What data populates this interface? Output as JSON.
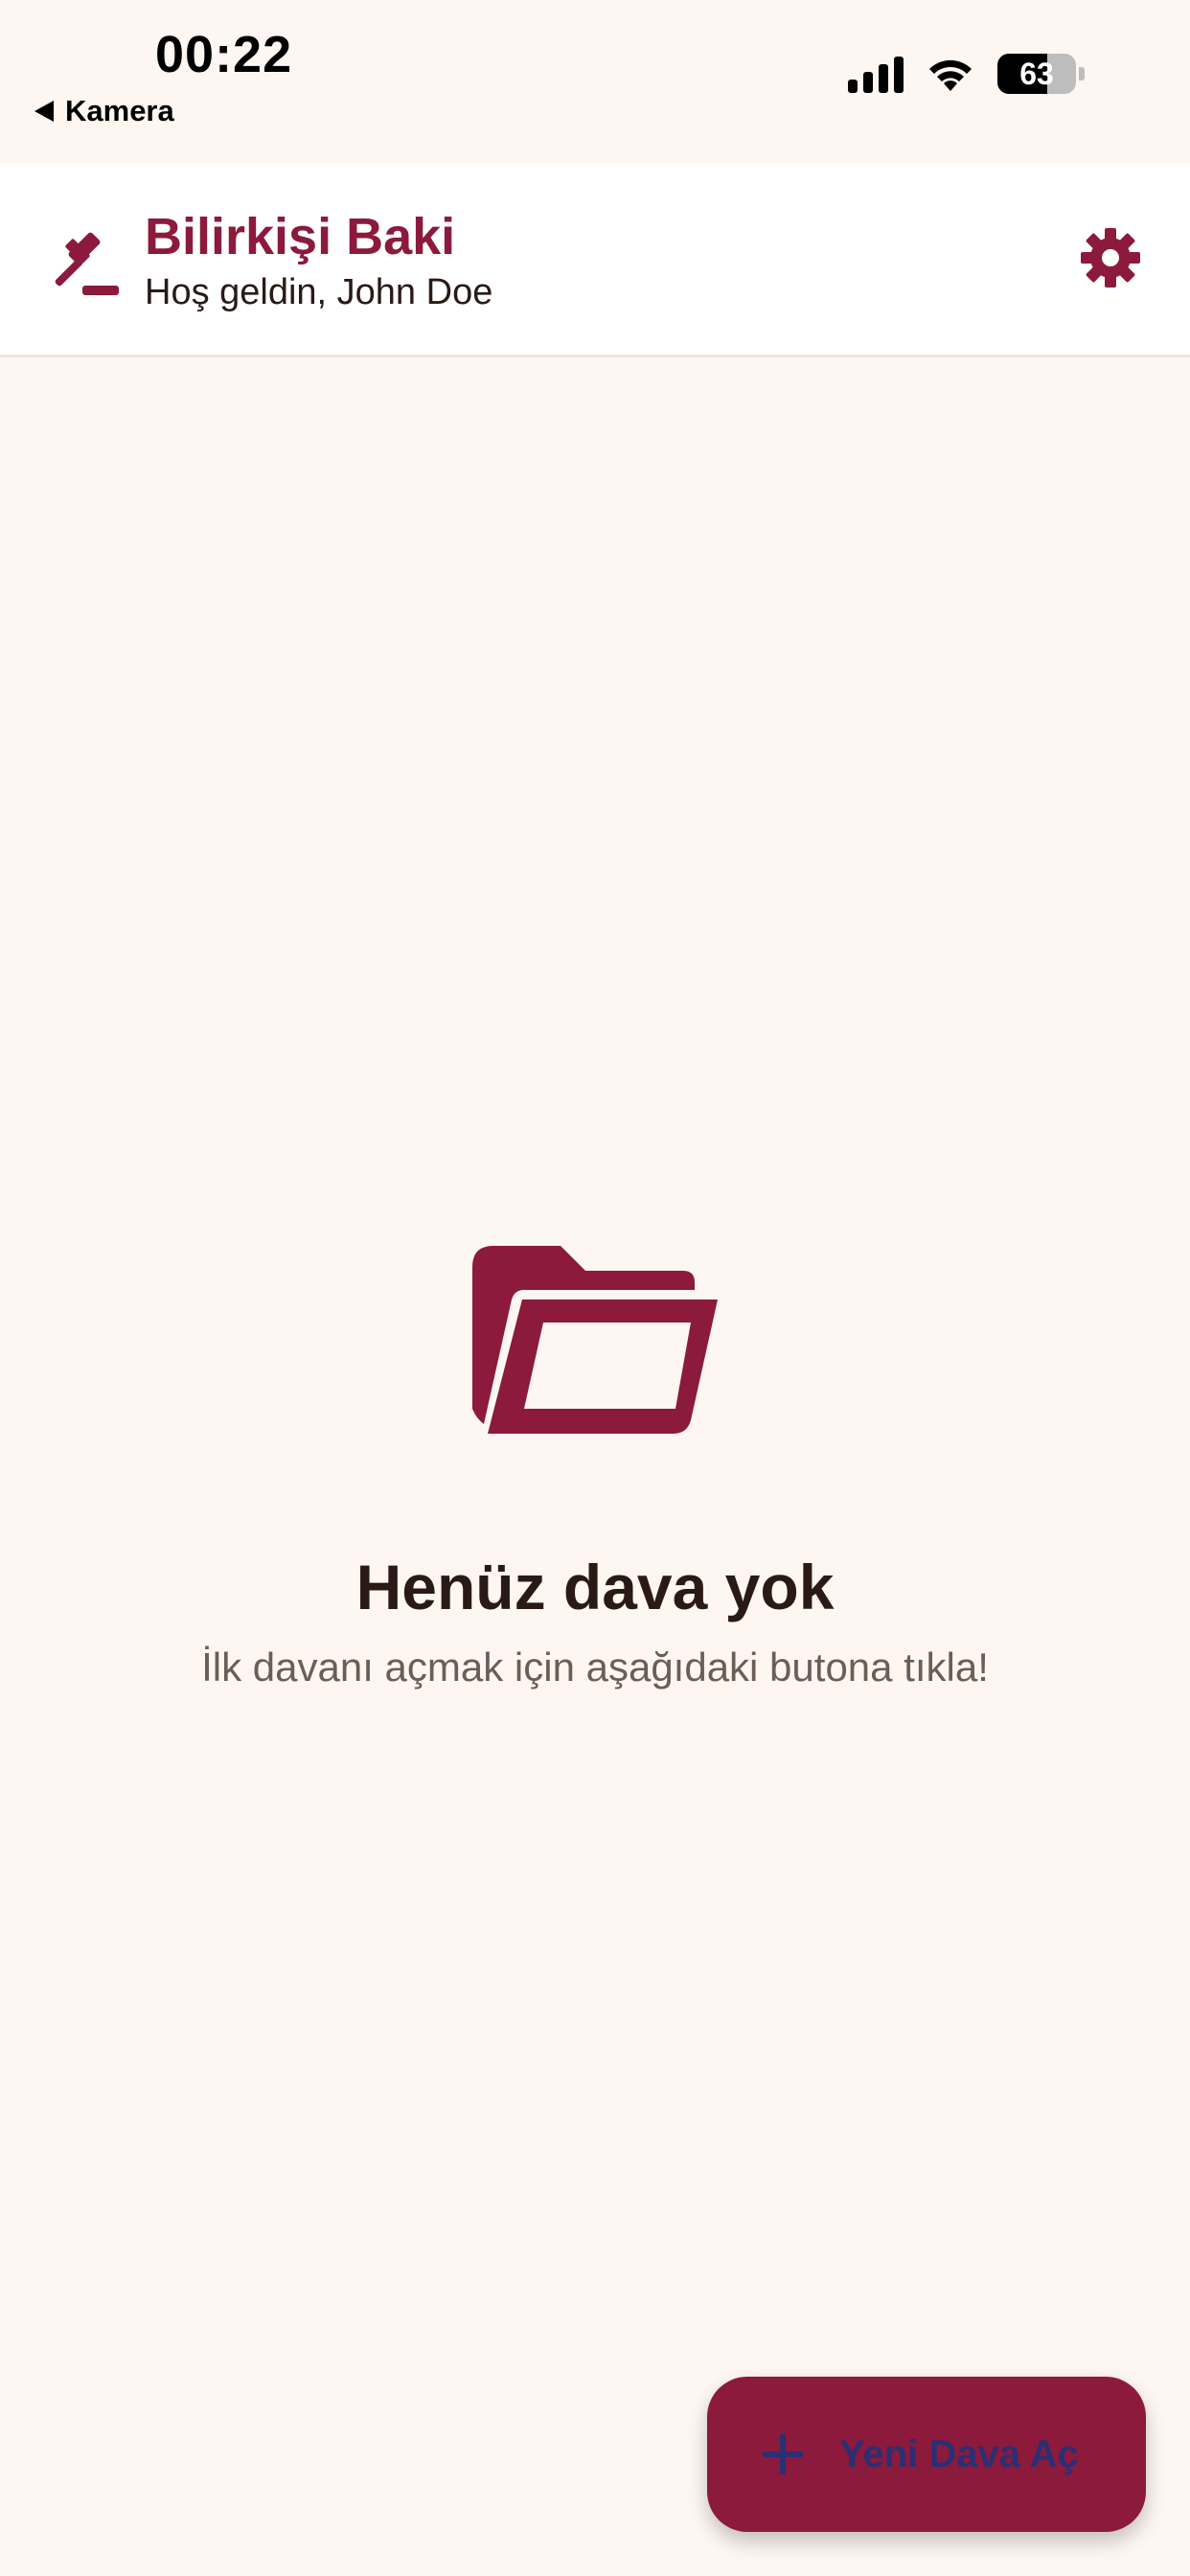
{
  "status_bar": {
    "time": "00:22",
    "back_label": "Kamera",
    "battery_percent": "63",
    "battery_level": 0.63
  },
  "header": {
    "title": "Bilirkişi Baki",
    "subtitle": "Hoş geldin, John Doe",
    "leading_icon": "gavel-icon",
    "trailing_icon": "gear-icon"
  },
  "empty_state": {
    "icon": "folder-open-icon",
    "title": "Henüz dava yok",
    "message": "İlk davanı açmak için aşağıdaki butona tıkla!"
  },
  "fab": {
    "icon": "plus-icon",
    "label": "Yeni Dava Aç"
  },
  "colors": {
    "accent": "#8B1A3C",
    "background": "#FDF6F1",
    "header_bg": "#FFFFFF",
    "text_dark": "#2A1A16",
    "text_muted": "#6B5D58",
    "fab_text": "#2B2F73"
  }
}
